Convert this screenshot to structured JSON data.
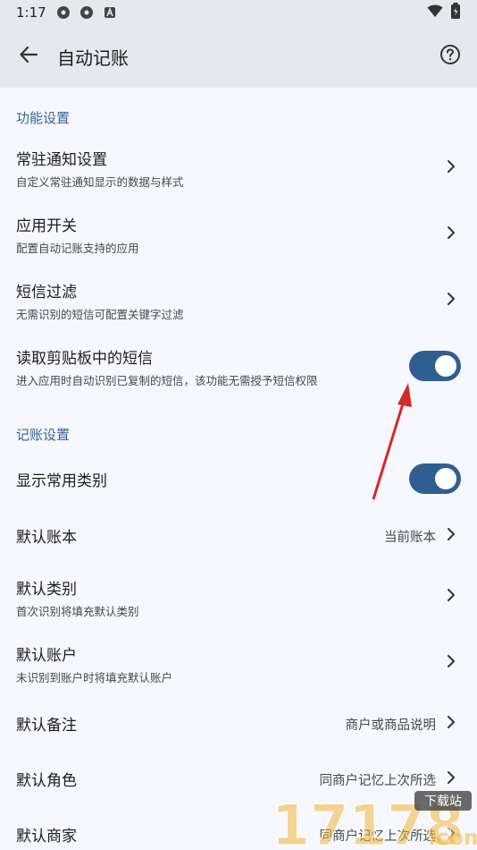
{
  "status": {
    "time": "1:17",
    "icons": [
      "gear-icon",
      "gear-icon",
      "a-icon"
    ],
    "right_icons": [
      "wifi-icon",
      "battery-icon"
    ]
  },
  "appbar": {
    "title": "自动记账",
    "back_icon": "arrow-left-icon",
    "help_icon": "help-circle-icon"
  },
  "sections": [
    {
      "title": "功能设置",
      "items": [
        {
          "title": "常驻通知设置",
          "subtitle": "自定义常驻通知显示的数据与样式",
          "control": "chevron"
        },
        {
          "title": "应用开关",
          "subtitle": "配置自动记账支持的应用",
          "control": "chevron"
        },
        {
          "title": "短信过滤",
          "subtitle": "无需识别的短信可配置关键字过滤",
          "control": "chevron"
        },
        {
          "title": "读取剪贴板中的短信",
          "subtitle": "进入应用时自动识别已复制的短信，该功能无需授予短信权限",
          "control": "switch",
          "on": true
        }
      ]
    },
    {
      "title": "记账设置",
      "items": [
        {
          "title": "显示常用类别",
          "control": "switch",
          "on": true
        },
        {
          "title": "默认账本",
          "value": "当前账本",
          "control": "chevron"
        },
        {
          "title": "默认类别",
          "subtitle": "首次识别将填充默认类别",
          "control": "chevron"
        },
        {
          "title": "默认账户",
          "subtitle": "未识别到账户时将填充默认账户",
          "control": "chevron"
        },
        {
          "title": "默认备注",
          "value": "商户或商品说明",
          "control": "chevron"
        },
        {
          "title": "默认角色",
          "value": "同商户记忆上次所选",
          "control": "chevron"
        },
        {
          "title": "默认商家",
          "value": "同商户记忆上次所选",
          "control": "chevron"
        }
      ]
    }
  ],
  "watermark": {
    "text": "17178",
    "badge": "下载站",
    "suffix": ".com"
  },
  "colors": {
    "accent": "#2f5f92",
    "section": "#3a6394",
    "appbar": "#e5e9ee",
    "background": "#f6f8fd",
    "annotation_arrow": "#d42a2a"
  }
}
